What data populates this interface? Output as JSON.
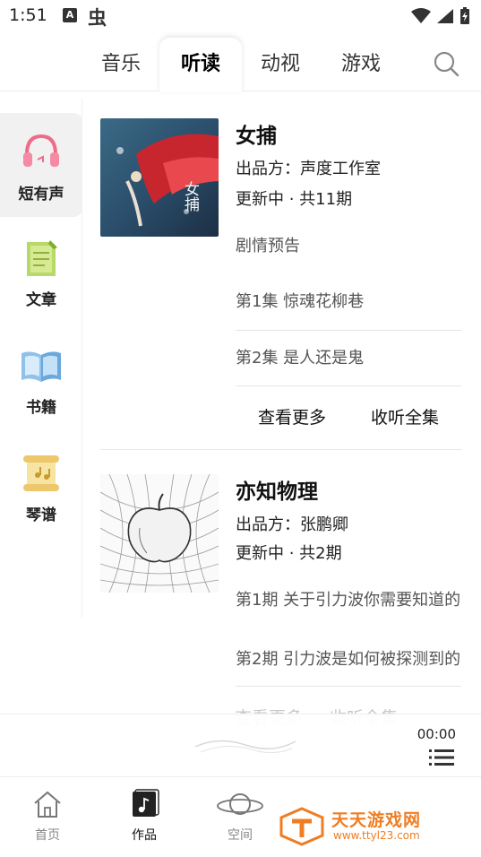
{
  "status_bar": {
    "time": "1:51",
    "a_badge": "A",
    "bug_glyph": "虫"
  },
  "top_tabs": [
    {
      "label": "音乐"
    },
    {
      "label": "听读"
    },
    {
      "label": "动视"
    },
    {
      "label": "游戏"
    }
  ],
  "active_top_tab": "听读",
  "sidebar": {
    "items": [
      {
        "label": "短有声",
        "icon": "headphones-icon"
      },
      {
        "label": "文章",
        "icon": "notepad-icon"
      },
      {
        "label": "书籍",
        "icon": "open-book-icon"
      },
      {
        "label": "琴谱",
        "icon": "scroll-icon"
      }
    ],
    "active": "短有声"
  },
  "cards": [
    {
      "title": "女捕",
      "producer": "出品方：声度工作室",
      "status": "更新中 · 共11期",
      "cover_text": "女捕",
      "episodes": [
        "剧情预告",
        "第1集 惊魂花柳巷",
        "第2集 是人还是鬼"
      ],
      "more_label": "查看更多",
      "listen_all_label": "收听全集"
    },
    {
      "title": "亦知物理",
      "producer": "出品方：张鹏卿",
      "status": "更新中 · 共2期",
      "episodes": [
        "第1期 关于引力波你需要知道的",
        "第2期 引力波是如何被探测到的"
      ],
      "more_label": "查看更多",
      "listen_all_label": "收听全集"
    }
  ],
  "player": {
    "time": "00:00"
  },
  "bottom_nav": [
    {
      "label": "首页",
      "icon": "home-icon"
    },
    {
      "label": "作品",
      "icon": "music-note-icon"
    },
    {
      "label": "空间",
      "icon": "planet-icon"
    }
  ],
  "watermark": {
    "title": "天天游戏网",
    "url": "www.ttyl23.com"
  },
  "colors": {
    "accent": "#ef7d22",
    "pink_icon": "#f06a8a",
    "divider": "#e6e6e6"
  }
}
